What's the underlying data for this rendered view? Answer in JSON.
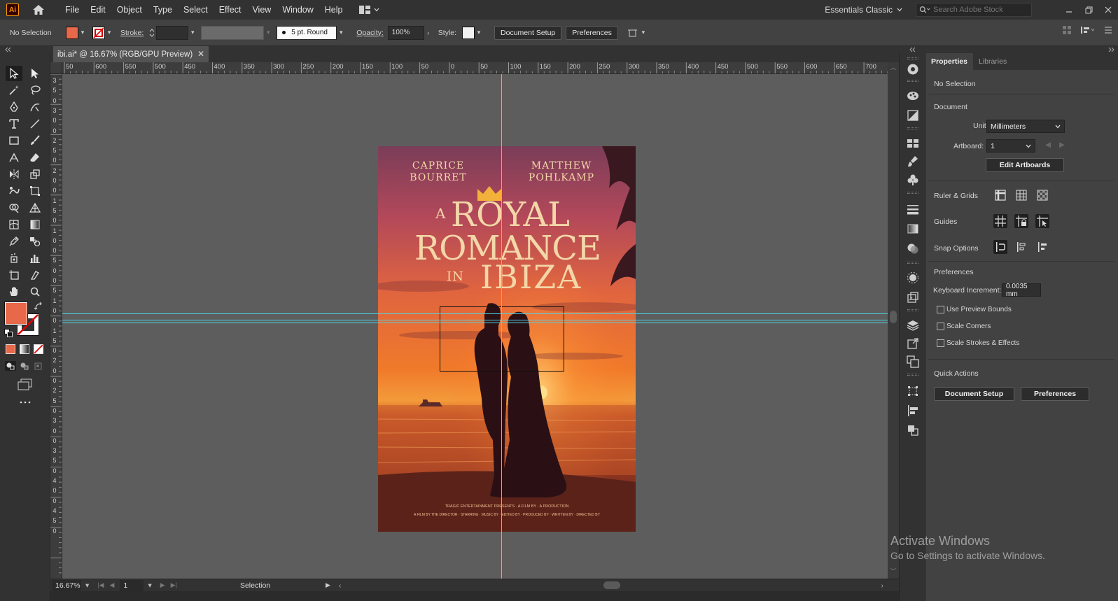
{
  "app": {
    "logo": "Ai",
    "menu": [
      "File",
      "Edit",
      "Object",
      "Type",
      "Select",
      "Effect",
      "View",
      "Window",
      "Help"
    ],
    "workspace": "Essentials Classic",
    "search_placeholder": "Search Adobe Stock"
  },
  "control": {
    "selection": "No Selection",
    "stroke_label": "Stroke:",
    "brush": "5 pt. Round",
    "opacity_label": "Opacity:",
    "opacity_value": "100%",
    "style_label": "Style:",
    "document_setup": "Document Setup",
    "preferences": "Preferences",
    "fill_color": "#e8694a"
  },
  "document": {
    "tab_title": "ibi.ai* @ 16.67% (RGB/GPU Preview)"
  },
  "ruler": {
    "h_labels": [
      "50",
      "600",
      "550",
      "500",
      "450",
      "400",
      "350",
      "300",
      "250",
      "200",
      "150",
      "100",
      "50",
      "0",
      "50",
      "100",
      "150",
      "200",
      "250",
      "300",
      "350",
      "400",
      "450",
      "500",
      "550",
      "600",
      "650",
      "700",
      "7"
    ],
    "v_labels": [
      "3",
      "5",
      "0",
      "3",
      "0",
      "0",
      "2",
      "5",
      "0",
      "2",
      "0",
      "0",
      "1",
      "5",
      "0",
      "1",
      "0",
      "0",
      "5",
      "0",
      "0",
      "5",
      "1",
      "0",
      "0",
      "1",
      "5",
      "0",
      "2",
      "0",
      "0",
      "2",
      "5",
      "0",
      "3",
      "0",
      "0",
      "3",
      "5",
      "0",
      "4",
      "0",
      "0",
      "4",
      "5",
      "0"
    ]
  },
  "poster": {
    "author_left_1": "CAPRICE",
    "author_left_2": "BOURRET",
    "author_right_1": "MATTHEW",
    "author_right_2": "POHLKAMP",
    "title_a": "A",
    "title_royal": "ROYAL",
    "title_romance": "ROMANCE",
    "title_in": "IN",
    "title_ibiza": "IBIZA",
    "credits_1": "TRAGIC ENTERTAINMENT PRESENTS · A FILM BY · A PRODUCTION",
    "credits_2": "A FILM BY THE DIRECTOR · STARRING · MUSIC BY · EDITED BY · PRODUCED BY · WRITTEN BY · DIRECTED BY"
  },
  "status": {
    "zoom": "16.67%",
    "artboard": "1",
    "tool": "Selection"
  },
  "properties": {
    "tabs": [
      "Properties",
      "Libraries"
    ],
    "selection": "No Selection",
    "document_heading": "Document",
    "units_label": "Units:",
    "units_value": "Millimeters",
    "artboard_label": "Artboard:",
    "artboard_value": "1",
    "edit_artboards": "Edit Artboards",
    "ruler_grids": "Ruler & Grids",
    "guides": "Guides",
    "snap_options": "Snap Options",
    "preferences_heading": "Preferences",
    "keyboard_increment_label": "Keyboard Increment:",
    "keyboard_increment_value": "0.0035 mm",
    "use_preview_bounds": "Use Preview Bounds",
    "scale_corners": "Scale Corners",
    "scale_strokes": "Scale Strokes & Effects",
    "quick_actions": "Quick Actions",
    "document_setup": "Document Setup",
    "preferences": "Preferences"
  },
  "watermark": {
    "line1": "Activate Windows",
    "line2": "Go to Settings to activate Windows."
  }
}
